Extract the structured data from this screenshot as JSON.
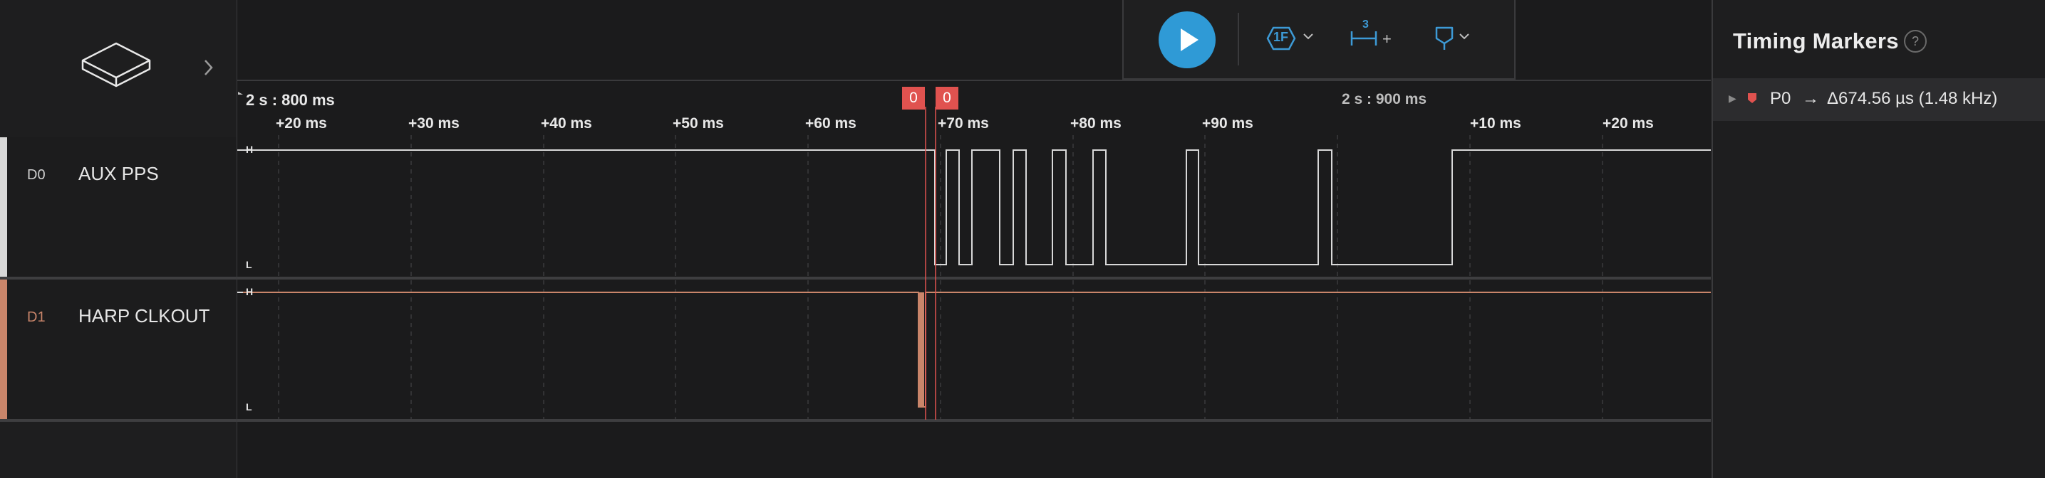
{
  "colors": {
    "accent": "#2f9ad6",
    "d0": "#d8d8d8",
    "d1": "#c9856a",
    "marker": "#e0524f",
    "toolbar_icon": "#3d9ad6"
  },
  "sidebar": {
    "expand_icon": "chevron-right-icon",
    "channels": [
      {
        "id": "D0",
        "name": "AUX PPS"
      },
      {
        "id": "D1",
        "name": "HARP CLKOUT"
      }
    ]
  },
  "timeline": {
    "major_left": "2 s : 800 ms",
    "major_right": "2 s : 900 ms",
    "ticks": [
      "+20 ms",
      "+30 ms",
      "+40 ms",
      "+50 ms",
      "+60 ms",
      "+70 ms",
      "+80 ms",
      "+90 ms",
      "+10 ms",
      "+20 ms"
    ],
    "markers": [
      "0",
      "0"
    ],
    "level_high": "H",
    "level_low": "L"
  },
  "toolbar": {
    "play_icon": "play-icon",
    "trigger_label": "1F",
    "measure_count": "3",
    "measure_add": "+",
    "marker_icon": "timing-marker-icon"
  },
  "panel": {
    "title": "Timing Markers",
    "help": "?",
    "marker": {
      "name": "P0",
      "arrow": "→",
      "delta": "Δ674.56 µs (1.48 kHz)"
    }
  }
}
